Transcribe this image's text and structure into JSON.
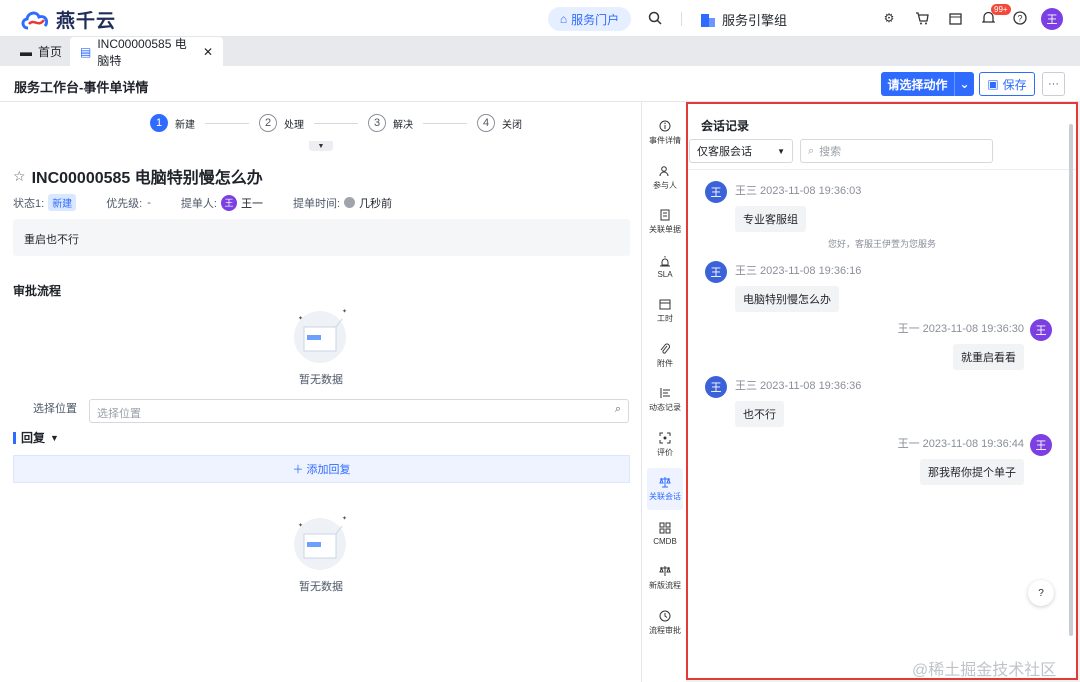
{
  "topbar": {
    "logo_text": "燕千云",
    "portal": "服务门户",
    "group": "服务引擎组",
    "badge": "99+",
    "avatar": "王"
  },
  "tabs": [
    {
      "label": "首页"
    },
    {
      "label": "INC00000585 电脑特"
    }
  ],
  "header": {
    "title": "服务工作台-事件单详情",
    "action_label": "请选择动作",
    "save_label": "保存",
    "more_label": "···"
  },
  "steps": [
    {
      "num": "1",
      "label": "新建"
    },
    {
      "num": "2",
      "label": "处理"
    },
    {
      "num": "3",
      "label": "解决"
    },
    {
      "num": "4",
      "label": "关闭"
    }
  ],
  "incident": {
    "title": "INC00000585  电脑特别慢怎么办",
    "status_label": "状态1:",
    "status": "新建",
    "priority_label": "优先级:",
    "priority": "-",
    "submitter_label": "提单人:",
    "submitter_avatar": "王",
    "submitter": "王一",
    "time_label": "提单时间:",
    "time": "几秒前",
    "description": "重启也不行"
  },
  "approval": {
    "title": "审批流程",
    "empty": "暂无数据"
  },
  "location": {
    "label": "选择位置",
    "placeholder": "选择位置"
  },
  "reply": {
    "title": "回复",
    "add": "添加回复",
    "empty": "暂无数据"
  },
  "rail": [
    {
      "label": "事件详情",
      "icon": "info-icon"
    },
    {
      "label": "参与人",
      "icon": "people-icon"
    },
    {
      "label": "关联单据",
      "icon": "document-icon"
    },
    {
      "label": "SLA",
      "icon": "alarm-icon"
    },
    {
      "label": "工时",
      "icon": "calendar-icon"
    },
    {
      "label": "附件",
      "icon": "paperclip-icon"
    },
    {
      "label": "动态记录",
      "icon": "timeline-icon"
    },
    {
      "label": "评价",
      "icon": "rating-icon"
    },
    {
      "label": "关联会话",
      "icon": "scale-icon"
    },
    {
      "label": "CMDB",
      "icon": "grid-icon"
    },
    {
      "label": "新版流程",
      "icon": "flow-icon"
    },
    {
      "label": "流程审批",
      "icon": "clock-icon"
    }
  ],
  "chat": {
    "title": "会话记录",
    "filter": "仅客服会话",
    "search_placeholder": "搜索",
    "system_msg": "您好，客服王伊萱为您服务",
    "messages": [
      {
        "name_time": "王三 2023-11-08 19:36:03",
        "text": "专业客服组",
        "avatar": "王"
      },
      {
        "name_time": "王三 2023-11-08 19:36:16",
        "text": "电脑特别慢怎么办",
        "avatar": "王"
      },
      {
        "name_time": "王一 2023-11-08 19:36:30",
        "text": "就重启看看",
        "avatar": "王"
      },
      {
        "name_time": "王三 2023-11-08 19:36:36",
        "text": "也不行",
        "avatar": "王"
      },
      {
        "name_time": "王一 2023-11-08 19:36:44",
        "text": "那我帮你提个单子",
        "avatar": "王"
      }
    ],
    "help": "?"
  },
  "watermark": "@稀土掘金技术社区",
  "colors": {
    "accent": "#2f6bff",
    "highlight_border": "#e53935",
    "avatar_purple": "#7b3fe4",
    "avatar_blue": "#3b62d8"
  }
}
